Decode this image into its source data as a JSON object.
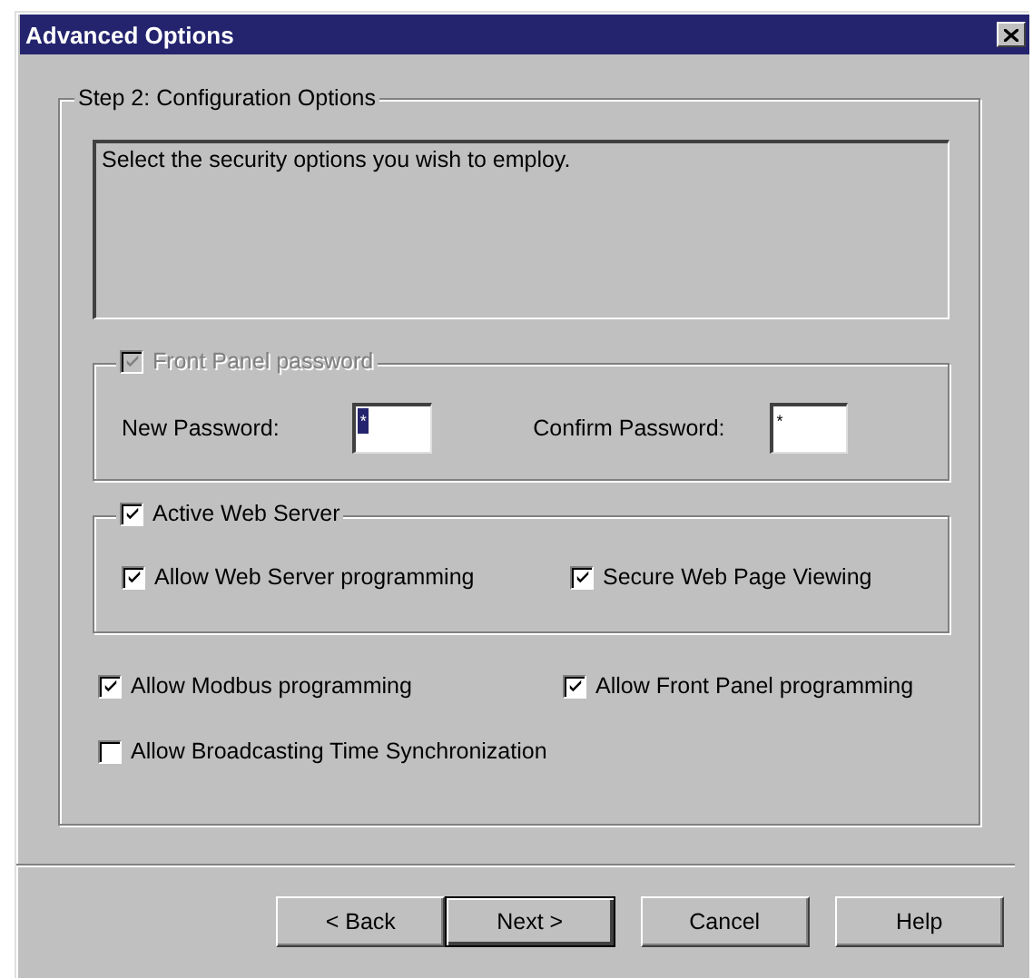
{
  "window": {
    "title": "Advanced Options"
  },
  "group": {
    "title": "Step 2: Configuration Options"
  },
  "description": "Select the security options you wish to employ.",
  "password_group": {
    "label": "Front Panel password",
    "checked": true,
    "disabled": true,
    "fields": [
      {
        "label": "New Password:",
        "value": "*",
        "selected": true
      },
      {
        "label": "Confirm Password:",
        "value": "*",
        "selected": false
      }
    ]
  },
  "web_group": {
    "label": "Active Web Server",
    "checked": true,
    "options": [
      {
        "label": "Allow Web Server programming",
        "checked": true
      },
      {
        "label": "Secure Web Page Viewing",
        "checked": true
      }
    ]
  },
  "options": [
    {
      "label": "Allow Modbus programming",
      "checked": true
    },
    {
      "label": "Allow Front Panel programming",
      "checked": true
    },
    {
      "label": "Allow Broadcasting Time Synchronization",
      "checked": false
    }
  ],
  "buttons": [
    {
      "label": "< Back",
      "default": false
    },
    {
      "label": "Next >",
      "default": true
    },
    {
      "label": "Cancel",
      "default": false
    },
    {
      "label": "Help",
      "default": false
    }
  ]
}
